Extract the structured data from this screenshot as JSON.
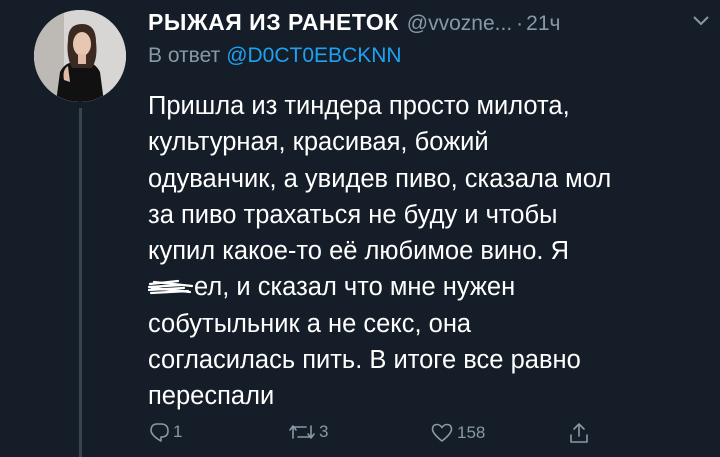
{
  "tweet": {
    "author_name": "РЫЖАЯ ИЗ РАНЕТОК",
    "handle": "@vvozne...",
    "separator": "·",
    "time": "21ч",
    "reply_label": "В ответ",
    "reply_handle": "@D0CT0EBCKNN",
    "body_lines": [
      "Пришла из тиндера просто милота,",
      "культурная, красивая, божий",
      "одуванчик, а увидев пиво, сказала мол",
      "за пиво трахаться не буду и чтобы",
      "купил какое-то её любимое вино. Я",
      "ел, и сказал что мне нужен",
      "собутыльник а не секс, она",
      "согласилась пить. В итоге все равно",
      "переспали"
    ],
    "avatar": "avatar-photo",
    "chevron_icon": "chevron-down-icon"
  },
  "actions": {
    "reply_count": "1",
    "retweet_count": "3",
    "like_count": "158",
    "icons": [
      "reply-icon",
      "retweet-icon",
      "like-icon",
      "share-icon"
    ]
  },
  "colors": {
    "background": "#151e28",
    "primary_text": "#ffffff",
    "secondary_text": "#8899a6",
    "link": "#1da1f2",
    "thread_line": "#38444d"
  }
}
